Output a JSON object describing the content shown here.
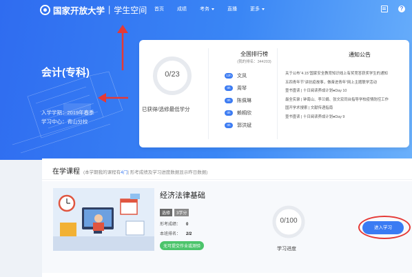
{
  "header": {
    "logo_main": "国家开放大学",
    "logo_separator": "|",
    "logo_sub": "学生空间",
    "nav": [
      {
        "label": "首页",
        "has_caret": false
      },
      {
        "label": "成绩",
        "has_caret": false
      },
      {
        "label": "考务",
        "has_caret": true
      },
      {
        "label": "直播",
        "has_caret": false
      },
      {
        "label": "更多",
        "has_caret": true
      }
    ],
    "icons": [
      "document-icon",
      "help-icon"
    ],
    "help_glyph": "?"
  },
  "profile": {
    "major": "会计(专科)",
    "enroll_label": "入学学期：",
    "enroll_value": "2019年春季",
    "center_label": "学习中心：",
    "center_value": "青山分校"
  },
  "credits": {
    "value": "0/23",
    "fraction": 0,
    "caption": "已获得/选修最低学分"
  },
  "ranking": {
    "title": "全国排行榜",
    "subtitle": "(我的排名：344203)",
    "items": [
      {
        "badge": "12h",
        "name": "文凤"
      },
      {
        "badge": "0h",
        "name": "周琴"
      },
      {
        "badge": "0h",
        "name": "陈佩琳"
      },
      {
        "badge": "0h",
        "name": "赖桐欣"
      },
      {
        "badge": "0h",
        "name": "郭洪斌"
      }
    ]
  },
  "notices": {
    "title": "通知公告",
    "items": [
      "关于公布“4.15”国家安全教育知识线上有奖竞答获奖学生的通知",
      "五四青年节“讲抗疫故事，做奋进青年”网上主题联学活动",
      "壹书壹读 | 十日阅读养成计划●Day 10",
      "最全实录 | 钟南山、李兰娟、张文宏同台指导学校疫情防控工作",
      "国开学术搜索 | 文献传递指南",
      "壹书壹读 | 十日阅读养成计划●Day 9"
    ]
  },
  "courses": {
    "title": "在学课程",
    "note_prefix": "(本学期我的课程有",
    "note_count": "4门",
    "note_suffix": "| 形考成绩及学习进度数据显示昨日数据)",
    "items": [
      {
        "name": "经济法律基础",
        "tags": [
          "选修",
          "3学分"
        ],
        "score_label": "形考成绩：",
        "score_value": "0",
        "rank_label": "本班排名：",
        "rank_value": "2/2",
        "status": "无可提交作业或测验",
        "progress": "0/100",
        "progress_fraction": 0,
        "progress_label": "学习进度",
        "action": "进入学习"
      }
    ]
  },
  "colors": {
    "brand": "#3a7bf3",
    "annotation_red": "#e53935",
    "status_green": "#4cc46b"
  }
}
